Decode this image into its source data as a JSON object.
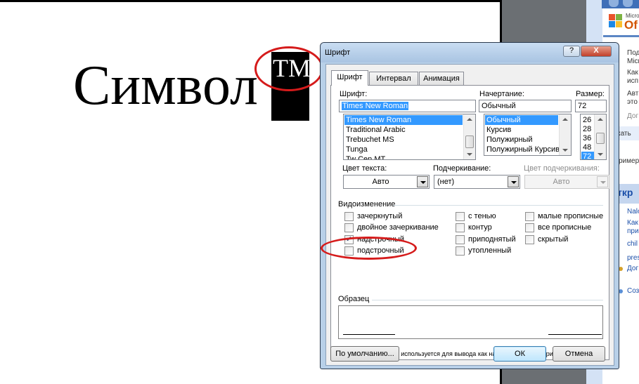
{
  "document": {
    "word": "Символ",
    "superscript": "TM"
  },
  "task_pane": {
    "brand_small": "Micro",
    "brand_big": "Of",
    "lines": [
      "Под",
      "Micr",
      "Как",
      "исп",
      "Авт",
      "это",
      "Дог",
      "кать",
      "ример",
      "ткр",
      "Nalo",
      "Как",
      "при",
      "chil",
      "pres",
      "Дог",
      "Соз"
    ]
  },
  "dialog": {
    "title": "Шрифт",
    "help": "?",
    "close": "X",
    "tabs": [
      "Шрифт",
      "Интервал",
      "Анимация"
    ],
    "font": {
      "label": "Шрифт:",
      "value": "Times New Roman",
      "items": [
        "Times New Roman",
        "Traditional Arabic",
        "Trebuchet MS",
        "Tunga",
        "Tw Cen MT"
      ]
    },
    "style": {
      "label": "Начертание:",
      "value": "Обычный",
      "items": [
        "Обычный",
        "Курсив",
        "Полужирный",
        "Полужирный Курсив"
      ]
    },
    "size": {
      "label": "Размер:",
      "value": "72",
      "items": [
        "26",
        "28",
        "36",
        "48",
        "72"
      ]
    },
    "color": {
      "label": "Цвет текста:",
      "value": "Авто"
    },
    "underline": {
      "label": "Подчеркивание:",
      "value": "(нет)"
    },
    "underline_color": {
      "label": "Цвет подчеркивания:",
      "value": "Авто"
    },
    "effects": {
      "label": "Видоизменение",
      "items": [
        {
          "label": "зачеркнутый",
          "checked": false
        },
        {
          "label": "двойное зачеркивание",
          "checked": false
        },
        {
          "label": "надстрочный",
          "checked": true
        },
        {
          "label": "подстрочный",
          "checked": false
        },
        {
          "label": "с тенью",
          "checked": false
        },
        {
          "label": "контур",
          "checked": false
        },
        {
          "label": "приподнятый",
          "checked": false
        },
        {
          "label": "утопленный",
          "checked": false
        },
        {
          "label": "малые прописные",
          "checked": false
        },
        {
          "label": "все прописные",
          "checked": false
        },
        {
          "label": "скрытый",
          "checked": false
        }
      ]
    },
    "preview_label": "Образец",
    "truetype_note": "Шрифт TrueType. Он используется для вывода как на экран, так и на принтер.",
    "buttons": {
      "default": "По умолчанию...",
      "ok": "ОК",
      "cancel": "Отмена"
    }
  },
  "colors": {
    "annotation_red": "#d51b1b",
    "selection_blue": "#3399ff",
    "dialog_frame": "#b8d0e8"
  }
}
